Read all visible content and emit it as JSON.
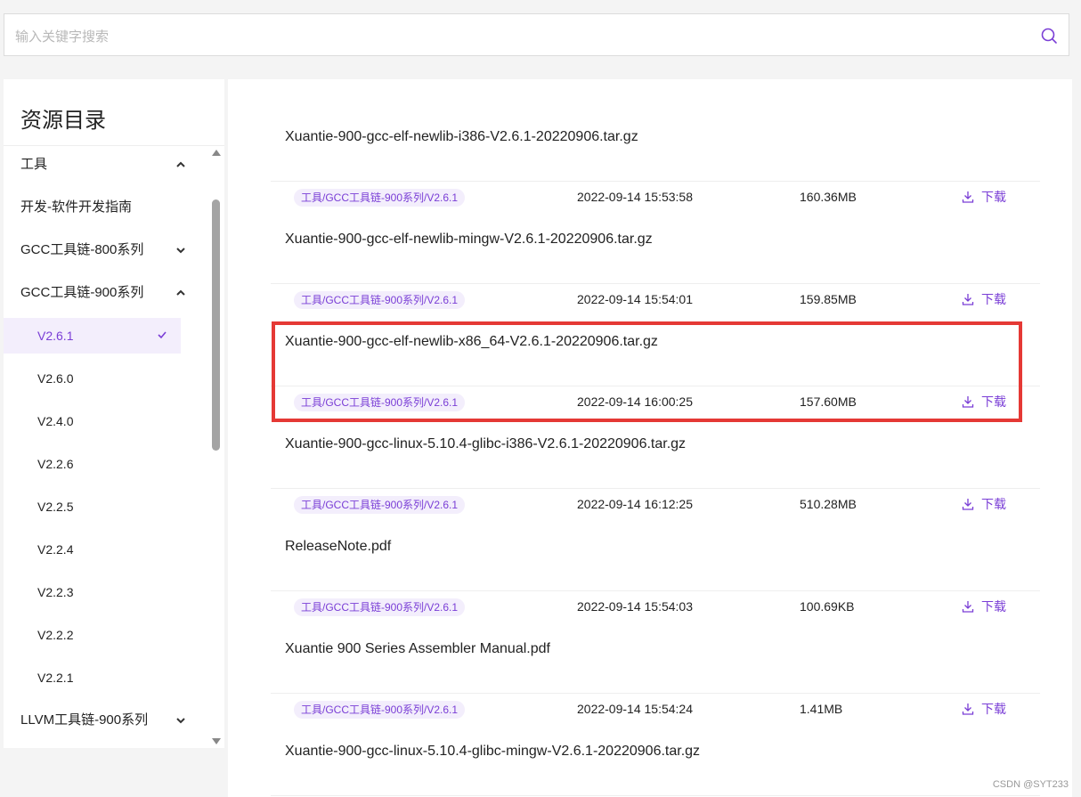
{
  "search": {
    "placeholder": "输入关键字搜索",
    "icon": "search-icon"
  },
  "sidebar": {
    "title": "资源目录",
    "items": [
      {
        "label": "工具",
        "level": 0,
        "chevron": "up"
      },
      {
        "label": "开发-软件开发指南",
        "level": 0,
        "chevron": ""
      },
      {
        "label": "GCC工具链-800系列",
        "level": 0,
        "chevron": "down"
      },
      {
        "label": "GCC工具链-900系列",
        "level": 0,
        "chevron": "up"
      },
      {
        "label": "V2.6.1",
        "level": 1,
        "active": true
      },
      {
        "label": "V2.6.0",
        "level": 1
      },
      {
        "label": "V2.4.0",
        "level": 1
      },
      {
        "label": "V2.2.6",
        "level": 1
      },
      {
        "label": "V2.2.5",
        "level": 1
      },
      {
        "label": "V2.2.4",
        "level": 1
      },
      {
        "label": "V2.2.3",
        "level": 1
      },
      {
        "label": "V2.2.2",
        "level": 1
      },
      {
        "label": "V2.2.1",
        "level": 1
      },
      {
        "label": "LLVM工具链-900系列",
        "level": 0,
        "chevron": "down"
      }
    ]
  },
  "files": [
    {
      "name": "Xuantie-900-gcc-elf-newlib-i386-V2.6.1-20220906.tar.gz",
      "tag": "工具/GCC工具链-900系列/V2.6.1",
      "date": "2022-09-14 15:53:58",
      "size": "160.36MB",
      "download": "下载"
    },
    {
      "name": "Xuantie-900-gcc-elf-newlib-mingw-V2.6.1-20220906.tar.gz",
      "tag": "工具/GCC工具链-900系列/V2.6.1",
      "date": "2022-09-14 15:54:01",
      "size": "159.85MB",
      "download": "下载"
    },
    {
      "name": "Xuantie-900-gcc-elf-newlib-x86_64-V2.6.1-20220906.tar.gz",
      "tag": "工具/GCC工具链-900系列/V2.6.1",
      "date": "2022-09-14 16:00:25",
      "size": "157.60MB",
      "download": "下载"
    },
    {
      "name": "Xuantie-900-gcc-linux-5.10.4-glibc-i386-V2.6.1-20220906.tar.gz",
      "tag": "工具/GCC工具链-900系列/V2.6.1",
      "date": "2022-09-14 16:12:25",
      "size": "510.28MB",
      "download": "下载"
    },
    {
      "name": "ReleaseNote.pdf",
      "tag": "工具/GCC工具链-900系列/V2.6.1",
      "date": "2022-09-14 15:54:03",
      "size": "100.69KB",
      "download": "下载"
    },
    {
      "name": "Xuantie 900 Series Assembler Manual.pdf",
      "tag": "工具/GCC工具链-900系列/V2.6.1",
      "date": "2022-09-14 15:54:24",
      "size": "1.41MB",
      "download": "下载"
    },
    {
      "name": "Xuantie-900-gcc-linux-5.10.4-glibc-mingw-V2.6.1-20220906.tar.gz"
    }
  ],
  "watermark": "CSDN @SYT233",
  "colors": {
    "accent": "#7a3ed6",
    "highlight": "#e53935",
    "tag_bg": "#f3eefc"
  }
}
